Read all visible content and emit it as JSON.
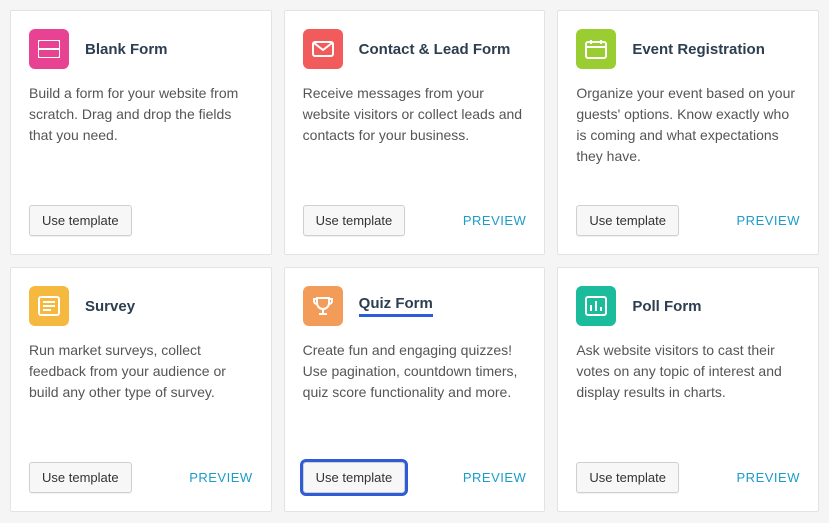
{
  "common": {
    "use_template": "Use template",
    "preview": "PREVIEW"
  },
  "cards": [
    {
      "title": "Blank Form",
      "desc": "Build a form for your website from scratch. Drag and drop the fields that you need.",
      "icon": "form-icon",
      "color": "pink",
      "show_preview": false,
      "selected": false
    },
    {
      "title": "Contact & Lead Form",
      "desc": "Receive messages from your website visitors or collect leads and contacts for your business.",
      "icon": "envelope-icon",
      "color": "red",
      "show_preview": true,
      "selected": false
    },
    {
      "title": "Event Registration",
      "desc": "Organize your event based on your guests' options. Know exactly who is coming and what expectations they have.",
      "icon": "calendar-icon",
      "color": "green",
      "show_preview": true,
      "selected": false
    },
    {
      "title": "Survey",
      "desc": "Run market surveys, collect feedback from your audience or build any other type of survey.",
      "icon": "survey-icon",
      "color": "yellow",
      "show_preview": true,
      "selected": false
    },
    {
      "title": "Quiz Form",
      "desc": "Create fun and engaging quizzes! Use pagination, countdown timers, quiz score functionality and more.",
      "icon": "trophy-icon",
      "color": "orange",
      "show_preview": true,
      "selected": true,
      "title_underlined": true
    },
    {
      "title": "Poll Form",
      "desc": "Ask website visitors to cast their votes on any topic of interest and display results in charts.",
      "icon": "poll-icon",
      "color": "teal",
      "show_preview": true,
      "selected": false
    }
  ]
}
